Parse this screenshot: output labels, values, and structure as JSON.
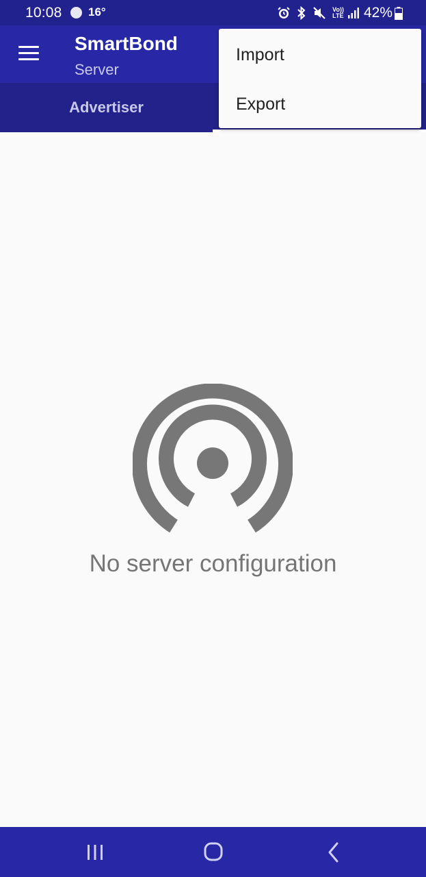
{
  "status_bar": {
    "time": "10:08",
    "temperature": "16°",
    "battery_percent": "42%",
    "icons": [
      "weather-icon",
      "alarm-icon",
      "bluetooth-icon",
      "mute-icon",
      "volte-icon",
      "signal-icon",
      "battery-icon"
    ],
    "volte_label_top": "Vo))",
    "volte_label_bottom": "LTE"
  },
  "app_bar": {
    "title": "SmartBond",
    "subtitle": "Server",
    "color": "#2828a6"
  },
  "tabs": [
    {
      "label": "Advertiser",
      "selected": false
    },
    {
      "label": "",
      "selected": true
    }
  ],
  "overflow_menu": {
    "items": [
      {
        "label": "Import"
      },
      {
        "label": "Export"
      }
    ]
  },
  "empty_state": {
    "icon": "broadcast-icon",
    "message": "No server configuration",
    "icon_color": "#777777"
  },
  "nav_bar": {
    "buttons": [
      "recent-apps-icon",
      "home-icon",
      "back-icon"
    ]
  }
}
